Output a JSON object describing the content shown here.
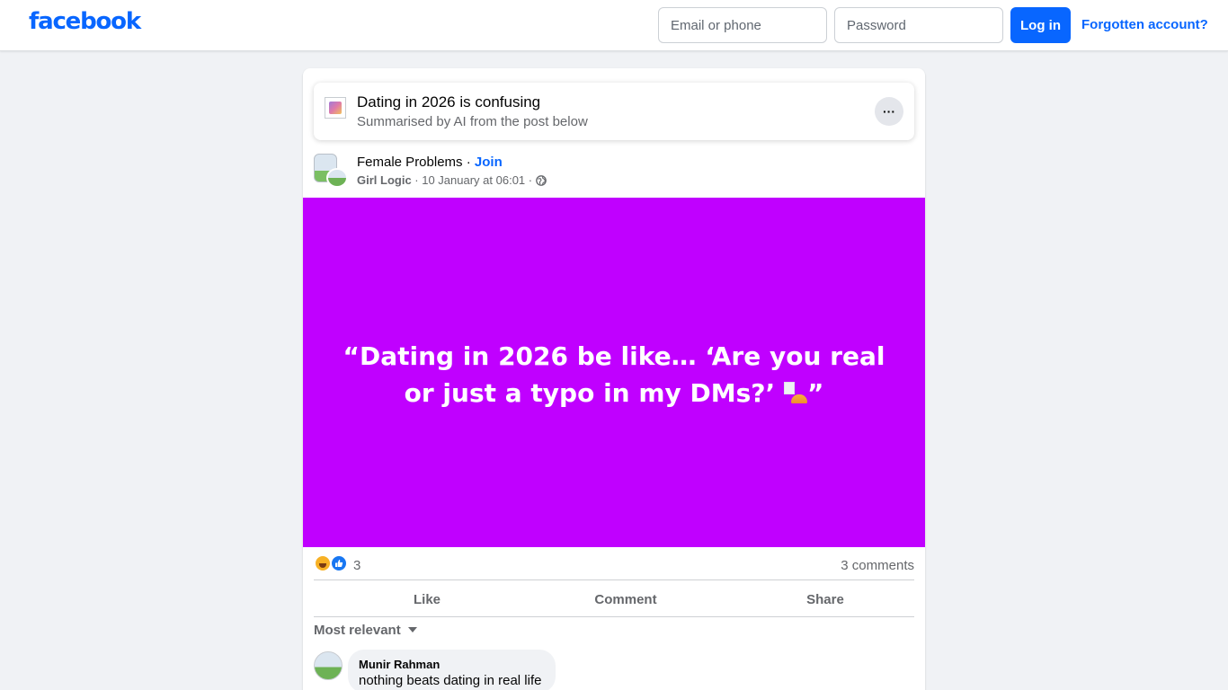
{
  "header": {
    "logo": "facebook",
    "email_placeholder": "Email or phone",
    "password_placeholder": "Password",
    "login_label": "Log in",
    "forgot_label": "Forgotten account?",
    "brand_color": "#0866ff"
  },
  "ai_summary": {
    "title": "Dating in 2026 is confusing",
    "subtitle": "Summarised by AI from the post below",
    "more_icon": "ellipsis-icon",
    "more_label": "···"
  },
  "post": {
    "group_name": "Female Problems",
    "separator": " · ",
    "join_label": "Join",
    "author": "Girl Logic",
    "timestamp": "10 January at 06:01",
    "meta_separator": " · ",
    "privacy_icon": "globe-icon",
    "text_open": "“Dating in 2026 be like… ‘Are you real or just a typo in my DMs?’ ",
    "text_close": "”",
    "background_color": "#c000ff",
    "text_color": "#ffffff"
  },
  "engagement": {
    "reaction_icons": [
      "haha-icon",
      "like-icon"
    ],
    "reaction_count": "3",
    "comments_count": "3 comments"
  },
  "actions": {
    "like": "Like",
    "comment": "Comment",
    "share": "Share"
  },
  "comments": {
    "sort_label": "Most relevant",
    "items": [
      {
        "author": "Munir Rahman",
        "text": "nothing beats dating in real life"
      }
    ]
  }
}
